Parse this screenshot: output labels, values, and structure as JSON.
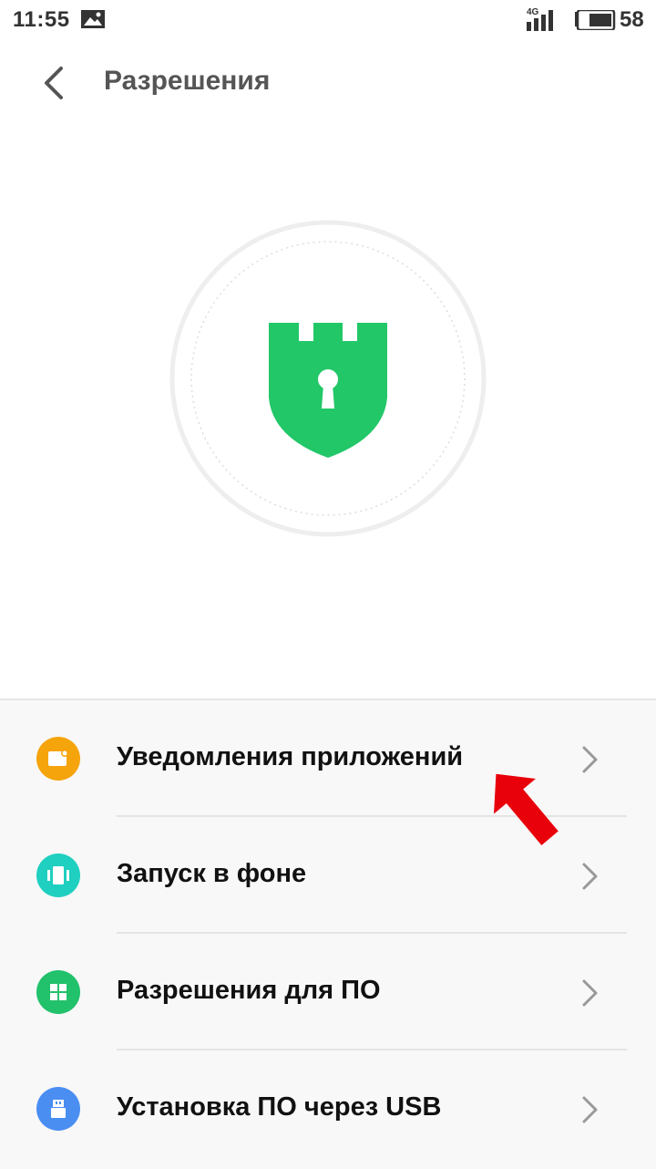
{
  "status_bar": {
    "time": "11:55",
    "network": "4G",
    "battery_level": "58"
  },
  "app_bar": {
    "title": "Разрешения",
    "back_icon": "chevron-left-icon"
  },
  "hero": {
    "icon": "shield-lock-icon",
    "color": "#22c768"
  },
  "permissions": [
    {
      "label": "Уведомления приложений",
      "icon": "notification-icon",
      "color": "#f5a40c"
    },
    {
      "label": "Запуск в фоне",
      "icon": "background-run-icon",
      "color": "#1fcfc0"
    },
    {
      "label": "Разрешения для ПО",
      "icon": "apps-grid-icon",
      "color": "#22c16b"
    },
    {
      "label": "Установка ПО через USB",
      "icon": "usb-icon",
      "color": "#4a8ef2"
    }
  ],
  "annotation": {
    "icon": "red-arrow-icon",
    "color": "#e8000b"
  }
}
